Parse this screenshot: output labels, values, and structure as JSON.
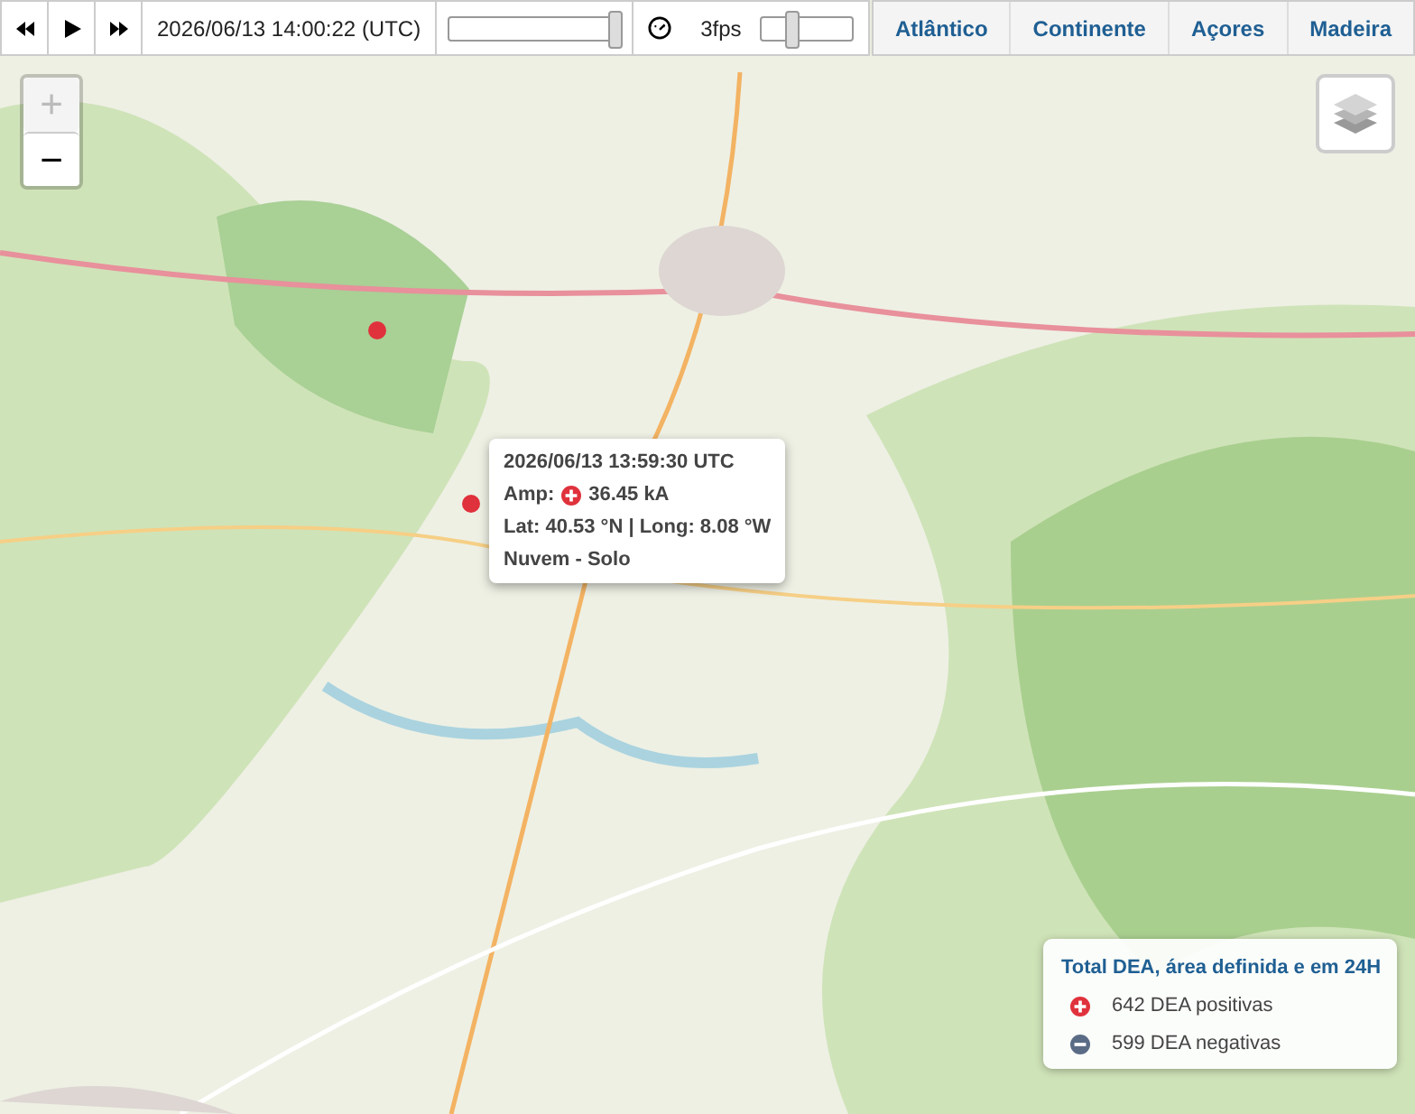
{
  "player": {
    "buttons": [
      {
        "kind": "rewind"
      },
      {
        "kind": "play"
      },
      {
        "kind": "forward"
      }
    ],
    "timestamp": "2026/06/13 14:00:22 (UTC)",
    "time_slider": {
      "level": 0.98
    },
    "speed": "3fps",
    "speed_slider": {
      "level": 0.35
    }
  },
  "regions": [
    {
      "label": "Atlântico",
      "selected": false
    },
    {
      "label": "Continente",
      "selected": false
    },
    {
      "label": "Açores",
      "selected": false
    },
    {
      "label": "Madeira",
      "selected": false
    }
  ],
  "zoom": {
    "zoom_in": {
      "label": "+",
      "disabled": true
    },
    "zoom_out": {
      "label": "−",
      "disabled": false
    }
  },
  "popup": {
    "time": "2026/06/13 13:59:30 UTC",
    "amp_label": "Amp:",
    "amp": {
      "kind": "positive",
      "value": "36.45 kA"
    },
    "position": "Lat: 40.53 °N | Long: 8.08 °W",
    "type": "Nuvem - Solo"
  },
  "legend": {
    "title": "Total DEA, área definida e em 24H",
    "items": [
      {
        "kind": "positive",
        "text": "642 DEA positivas"
      },
      {
        "kind": "negative",
        "text": "599 DEA negativas"
      }
    ]
  }
}
